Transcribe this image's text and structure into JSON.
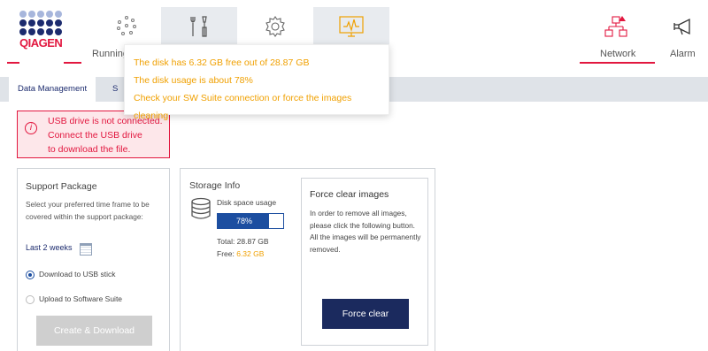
{
  "brand": {
    "name": "QIAGEN",
    "color": "#e2173f",
    "navy": "#1c2b6e"
  },
  "nav": {
    "running_label": "Running",
    "network_label": "Network",
    "alarm_label": "Alarm",
    "icons": [
      "running-icon",
      "tools-icon",
      "gear-icon",
      "monitor-icon",
      "network-icon",
      "alarm-icon"
    ]
  },
  "subnav": {
    "tab1": "Data Management",
    "tab2": "S"
  },
  "tooltip": {
    "line1": "The disk has 6.32 GB free out of 28.87 GB",
    "line2": "The disk usage is about 78%",
    "line3": "Check your SW Suite connection or force the images cleaning"
  },
  "alert": {
    "line1": "USB drive is not connected.",
    "line2": "Connect the USB drive",
    "line3": "to download the file."
  },
  "support": {
    "title": "Support Package",
    "desc": "Select your preferred time frame to be covered within the support package:",
    "period": "Last 2 weeks",
    "option_usb": "Download to USB stick",
    "option_suite": "Upload to Software Suite",
    "button": "Create & Download"
  },
  "storage": {
    "title": "Storage Info",
    "usage_label": "Disk space usage",
    "usage_percent": "78%",
    "usage_fraction": 0.78,
    "total": "Total: 28.87 GB",
    "free_label": "Free:",
    "free_value": "6.32 GB"
  },
  "force": {
    "title": "Force clear images",
    "desc": "In order to remove all images, please click the following button. All the images will be permanently removed.",
    "button": "Force clear"
  }
}
